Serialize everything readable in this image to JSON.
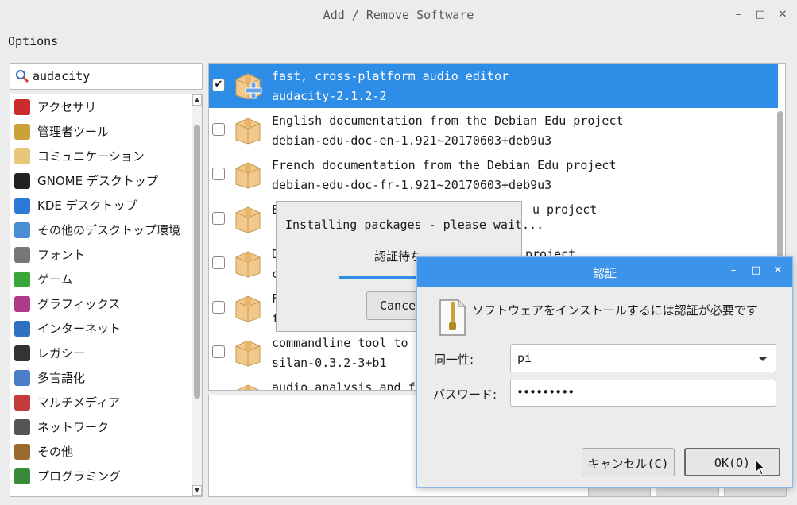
{
  "window": {
    "title": "Add / Remove Software",
    "controls": [
      "–",
      "□",
      "✕"
    ]
  },
  "menu": {
    "options": "Options"
  },
  "search": {
    "value": "audacity"
  },
  "categories": [
    {
      "label": "アクセサリ",
      "icon": "accessories-icon",
      "color": "#cc2b2b"
    },
    {
      "label": "管理者ツール",
      "icon": "admin-tools-icon",
      "color": "#c9a23a"
    },
    {
      "label": "コミュニケーション",
      "icon": "communication-icon",
      "color": "#e9c77a"
    },
    {
      "label": "GNOME デスクトップ",
      "icon": "gnome-icon",
      "color": "#222222"
    },
    {
      "label": "KDE デスクトップ",
      "icon": "kde-icon",
      "color": "#2b7ad8"
    },
    {
      "label": "その他のデスクトップ環境",
      "icon": "desktop-icon",
      "color": "#4a8fd6"
    },
    {
      "label": "フォント",
      "icon": "font-icon",
      "color": "#777777"
    },
    {
      "label": "ゲーム",
      "icon": "games-icon",
      "color": "#3aa63a"
    },
    {
      "label": "グラフィックス",
      "icon": "graphics-icon",
      "color": "#b03a8a"
    },
    {
      "label": "インターネット",
      "icon": "internet-icon",
      "color": "#2f6fc4"
    },
    {
      "label": "レガシー",
      "icon": "legacy-icon",
      "color": "#333333"
    },
    {
      "label": "多言語化",
      "icon": "localization-icon",
      "color": "#4a7fc7"
    },
    {
      "label": "マルチメディア",
      "icon": "multimedia-icon",
      "color": "#c43b3b"
    },
    {
      "label": "ネットワーク",
      "icon": "network-icon",
      "color": "#555555"
    },
    {
      "label": "その他",
      "icon": "other-icon",
      "color": "#9b6a2e"
    },
    {
      "label": "プログラミング",
      "icon": "programming-icon",
      "color": "#3a8a3a"
    }
  ],
  "packages": [
    {
      "summary": "fast, cross-platform audio editor",
      "id": "audacity-2.1.2-2",
      "checked": true,
      "selected": true
    },
    {
      "summary": "English documentation from the Debian Edu project",
      "id": "debian-edu-doc-en-1.921~20170603+deb9u3",
      "checked": false
    },
    {
      "summary": "French documentation from the Debian Edu project",
      "id": "debian-edu-doc-fr-1.921~20170603+deb9u3",
      "checked": false
    },
    {
      "summary": "E",
      "summary_tail": "u project",
      "id": "",
      "checked": false
    },
    {
      "summary": "D",
      "summary_tail": "project",
      "id": "c",
      "checked": false
    },
    {
      "summary": "F",
      "id": "f",
      "checked": false
    },
    {
      "summary": "commandline tool to det",
      "id": "silan-0.3.2-3+b1",
      "checked": false
    },
    {
      "summary": "audio analysis and feat",
      "id": "",
      "checked": false
    }
  ],
  "progress": {
    "title": "Installing packages - please wait...",
    "status": "認証待ち",
    "cancel": "Cance",
    "percent": 40
  },
  "auth": {
    "title": "認証",
    "message": "ソフトウェアをインストールするには認証が必要です",
    "identity_label": "同一性:",
    "identity_value": "pi",
    "password_label": "パスワード:",
    "password_value": "•••••••••",
    "cancel": "キャンセル(C)",
    "ok": "OK(O)"
  },
  "colors": {
    "selection": "#2e8de6",
    "auth_titlebar": "#3b93ea"
  }
}
